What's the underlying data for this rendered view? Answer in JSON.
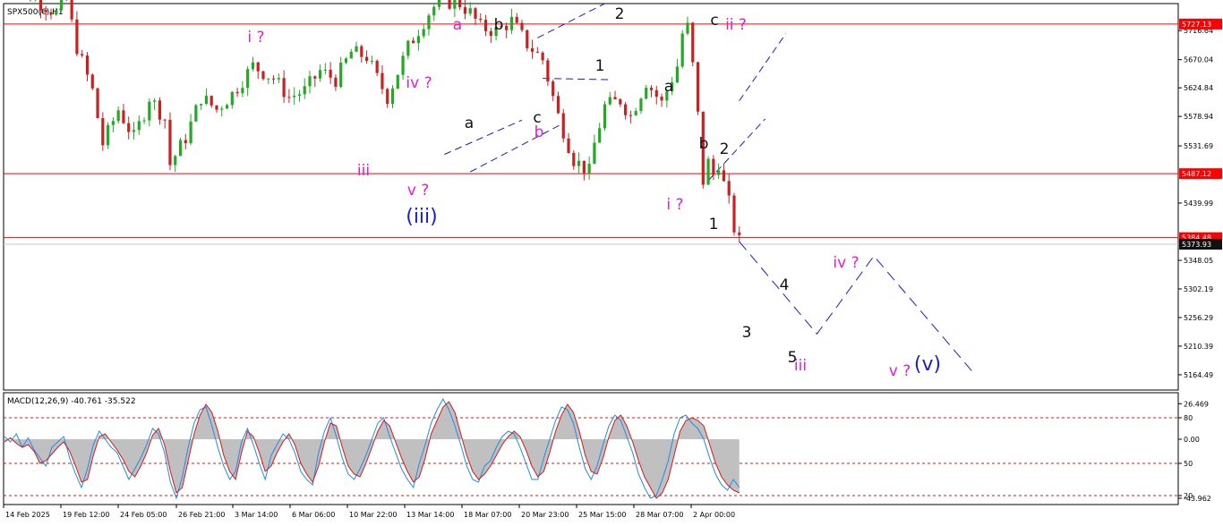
{
  "chart_data": [
    {
      "type": "line",
      "title": "SPX500(€),H1",
      "ylim": [
        5140,
        5760
      ],
      "yticks": [
        "5716.64",
        "5670.04",
        "5624.84",
        "5578.94",
        "5531.69",
        "5439.99",
        "5348.05",
        "5302.19",
        "5256.29",
        "5210.39",
        "5164.49"
      ],
      "hlines": [
        {
          "value": 5727.13,
          "label": "5727.13",
          "color": "#ff0000"
        },
        {
          "value": 5487.12,
          "label": "5487.12",
          "color": "#ff0000"
        },
        {
          "value": 5384.48,
          "label": "5384.48",
          "color": "#ff0000"
        }
      ],
      "current_price": {
        "value": 5373.93,
        "label": "5373.93",
        "color": "#c0c8c8"
      },
      "xticks": [
        "14 Feb 2025",
        "19 Feb 12:00",
        "24 Feb 05:00",
        "26 Feb 21:00",
        "3 Mar 14:00",
        "6 Mar 06:00",
        "10 Mar 22:00",
        "13 Mar 14:00",
        "18 Mar 07:00",
        "20 Mar 23:00",
        "25 Mar 15:00",
        "28 Mar 07:00",
        "2 Apr 00:00"
      ],
      "price_path": [
        [
          0,
          5800
        ],
        [
          10,
          5745
        ],
        [
          12,
          5765
        ],
        [
          14,
          5690
        ],
        [
          17,
          5620
        ],
        [
          19,
          5535
        ],
        [
          22,
          5590
        ],
        [
          25,
          5545
        ],
        [
          27,
          5585
        ],
        [
          28,
          5610
        ],
        [
          31,
          5575
        ],
        [
          32,
          5502
        ],
        [
          35,
          5545
        ],
        [
          38,
          5610
        ],
        [
          41,
          5590
        ],
        [
          44,
          5615
        ],
        [
          48,
          5660
        ],
        [
          52,
          5640
        ],
        [
          55,
          5610
        ],
        [
          58,
          5620
        ],
        [
          61,
          5652
        ],
        [
          64,
          5638
        ],
        [
          67,
          5682
        ],
        [
          70,
          5675
        ],
        [
          72,
          5640
        ],
        [
          74,
          5610
        ],
        [
          78,
          5690
        ],
        [
          82,
          5745
        ],
        [
          84,
          5765
        ],
        [
          88,
          5760
        ],
        [
          90,
          5745
        ],
        [
          92,
          5722
        ],
        [
          95,
          5716
        ],
        [
          98,
          5732
        ],
        [
          101,
          5695
        ],
        [
          104,
          5670
        ],
        [
          105,
          5640
        ],
        [
          107,
          5580
        ],
        [
          110,
          5510
        ],
        [
          113,
          5490
        ],
        [
          114,
          5535
        ],
        [
          116,
          5595
        ],
        [
          119,
          5605
        ],
        [
          121,
          5580
        ],
        [
          124,
          5635
        ],
        [
          127,
          5600
        ],
        [
          130,
          5660
        ],
        [
          131,
          5712
        ],
        [
          132,
          5722
        ],
        [
          133,
          5660
        ],
        [
          134,
          5580
        ],
        [
          135,
          5475
        ],
        [
          136,
          5505
        ],
        [
          137,
          5485
        ],
        [
          138,
          5505
        ],
        [
          139,
          5470
        ],
        [
          140,
          5440
        ],
        [
          141,
          5400
        ],
        [
          142,
          5378
        ]
      ],
      "projection_path": [
        [
          142,
          5378
        ],
        [
          157,
          5230
        ],
        [
          168,
          5355
        ],
        [
          187,
          5170
        ]
      ],
      "channels": [
        {
          "from": [
            85,
            5518
          ],
          "to": [
            100,
            5573
          ],
          "color": "#1a1ad8"
        },
        {
          "from": [
            90,
            5490
          ],
          "to": [
            108,
            5568
          ],
          "color": "#1a1ad8"
        },
        {
          "from": [
            104,
            5640
          ],
          "to": [
            117,
            5638
          ],
          "color": "#1a1ad8"
        },
        {
          "from": [
            103,
            5705
          ],
          "to": [
            116,
            5760
          ],
          "color": "#1a1ad8"
        },
        {
          "from": [
            136,
            5476
          ],
          "to": [
            147,
            5575
          ],
          "color": "#1a1ad8"
        },
        {
          "from": [
            142,
            5604
          ],
          "to": [
            151,
            5712
          ],
          "color": "#1a1ad8"
        }
      ],
      "wave_labels": [
        {
          "text": "i ?",
          "color": "#e020d0",
          "size": "md"
        },
        {
          "text": "a",
          "color": "#e020d0",
          "size": "md"
        },
        {
          "text": "b",
          "color": "#111111",
          "size": "md"
        },
        {
          "text": "iv ?",
          "color": "#e020d0",
          "size": "md"
        },
        {
          "text": "a",
          "color": "#111111",
          "size": "md"
        },
        {
          "text": "c",
          "color": "#111111",
          "size": "md"
        },
        {
          "text": "b",
          "color": "#e020d0",
          "size": "md"
        },
        {
          "text": "iii",
          "color": "#e020d0",
          "size": "md"
        },
        {
          "text": "v ?",
          "color": "#e020d0",
          "size": "md"
        },
        {
          "text": "(iii)",
          "color": "#1a1ad8",
          "size": "lg"
        },
        {
          "text": "2",
          "color": "#111111",
          "size": "md"
        },
        {
          "text": "1",
          "color": "#111111",
          "size": "md"
        },
        {
          "text": "c",
          "color": "#111111",
          "size": "md"
        },
        {
          "text": "ii ?",
          "color": "#e020d0",
          "size": "md"
        },
        {
          "text": "a",
          "color": "#111111",
          "size": "md"
        },
        {
          "text": "b",
          "color": "#111111",
          "size": "md"
        },
        {
          "text": "2",
          "color": "#111111",
          "size": "md"
        },
        {
          "text": "i ?",
          "color": "#e020d0",
          "size": "md"
        },
        {
          "text": "1",
          "color": "#111111",
          "size": "md"
        },
        {
          "text": "4",
          "color": "#111111",
          "size": "md"
        },
        {
          "text": "iv ?",
          "color": "#e020d0",
          "size": "md"
        },
        {
          "text": "3",
          "color": "#111111",
          "size": "md"
        },
        {
          "text": "5",
          "color": "#111111",
          "size": "md"
        },
        {
          "text": "iii",
          "color": "#e020d0",
          "size": "md"
        },
        {
          "text": "v ?",
          "color": "#e020d0",
          "size": "md"
        },
        {
          "text": "(v)",
          "color": "#1a1ad8",
          "size": "lg"
        }
      ]
    },
    {
      "type": "line",
      "title": "MACD(12,26,9) -40.761 -35.522",
      "ylim": [
        -48,
        34
      ],
      "yticks": [
        "26.469",
        "80",
        "0.00",
        "50",
        "20",
        "-43.962"
      ],
      "level_lines": [
        16,
        -18,
        -42
      ],
      "series": [
        {
          "color": "#d81818",
          "values": [
            -2,
            1,
            -3,
            -6,
            -4,
            -9,
            -18,
            -16,
            -11,
            -6,
            -2,
            -9,
            -20,
            -32,
            -30,
            -12,
            2,
            4,
            -2,
            -8,
            -15,
            -24,
            -28,
            -20,
            -10,
            3,
            8,
            -4,
            -24,
            -40,
            -36,
            -16,
            4,
            18,
            26,
            20,
            6,
            -12,
            -24,
            -30,
            -10,
            6,
            2,
            -10,
            -24,
            -20,
            -10,
            -2,
            4,
            -4,
            -18,
            -26,
            -32,
            -20,
            -2,
            12,
            10,
            -6,
            -20,
            -26,
            -28,
            -18,
            -6,
            6,
            14,
            10,
            -2,
            -14,
            -24,
            -32,
            -28,
            -14,
            4,
            14,
            24,
            28,
            20,
            4,
            -12,
            -24,
            -30,
            -26,
            -20,
            -12,
            -4,
            2,
            6,
            2,
            -8,
            -20,
            -28,
            -24,
            -10,
            6,
            18,
            26,
            20,
            6,
            -12,
            -24,
            -26,
            -14,
            2,
            14,
            18,
            10,
            -2,
            -16,
            -28,
            -36,
            -44,
            -40,
            -30,
            -12,
            6,
            14,
            16,
            14,
            10,
            -4,
            -18,
            -28,
            -34,
            -38,
            -40
          ]
        },
        {
          "color": "#1a8cf0",
          "values": [
            2,
            -2,
            4,
            -6,
            1,
            -8,
            -14,
            -20,
            -6,
            -2,
            2,
            -14,
            -26,
            -36,
            -22,
            -4,
            6,
            0,
            -6,
            -10,
            -20,
            -30,
            -22,
            -14,
            -4,
            8,
            4,
            -10,
            -32,
            -44,
            -28,
            -6,
            12,
            22,
            24,
            10,
            -6,
            -20,
            -30,
            -24,
            -2,
            8,
            -4,
            -18,
            -30,
            -12,
            -4,
            4,
            0,
            -10,
            -24,
            -30,
            -34,
            -10,
            6,
            16,
            2,
            -14,
            -26,
            -30,
            -22,
            -12,
            0,
            12,
            16,
            2,
            -10,
            -22,
            -30,
            -36,
            -18,
            -4,
            12,
            22,
            30,
            22,
            10,
            -4,
            -20,
            -30,
            -32,
            -20,
            -16,
            -6,
            2,
            6,
            4,
            -6,
            -18,
            -30,
            -30,
            -14,
            0,
            14,
            24,
            22,
            12,
            -6,
            -22,
            -30,
            -20,
            -4,
            10,
            18,
            14,
            2,
            -10,
            -26,
            -36,
            -44,
            -42,
            -30,
            -16,
            4,
            16,
            18,
            12,
            8,
            0,
            -14,
            -26,
            -34,
            -38,
            -30,
            -36
          ]
        }
      ]
    }
  ]
}
